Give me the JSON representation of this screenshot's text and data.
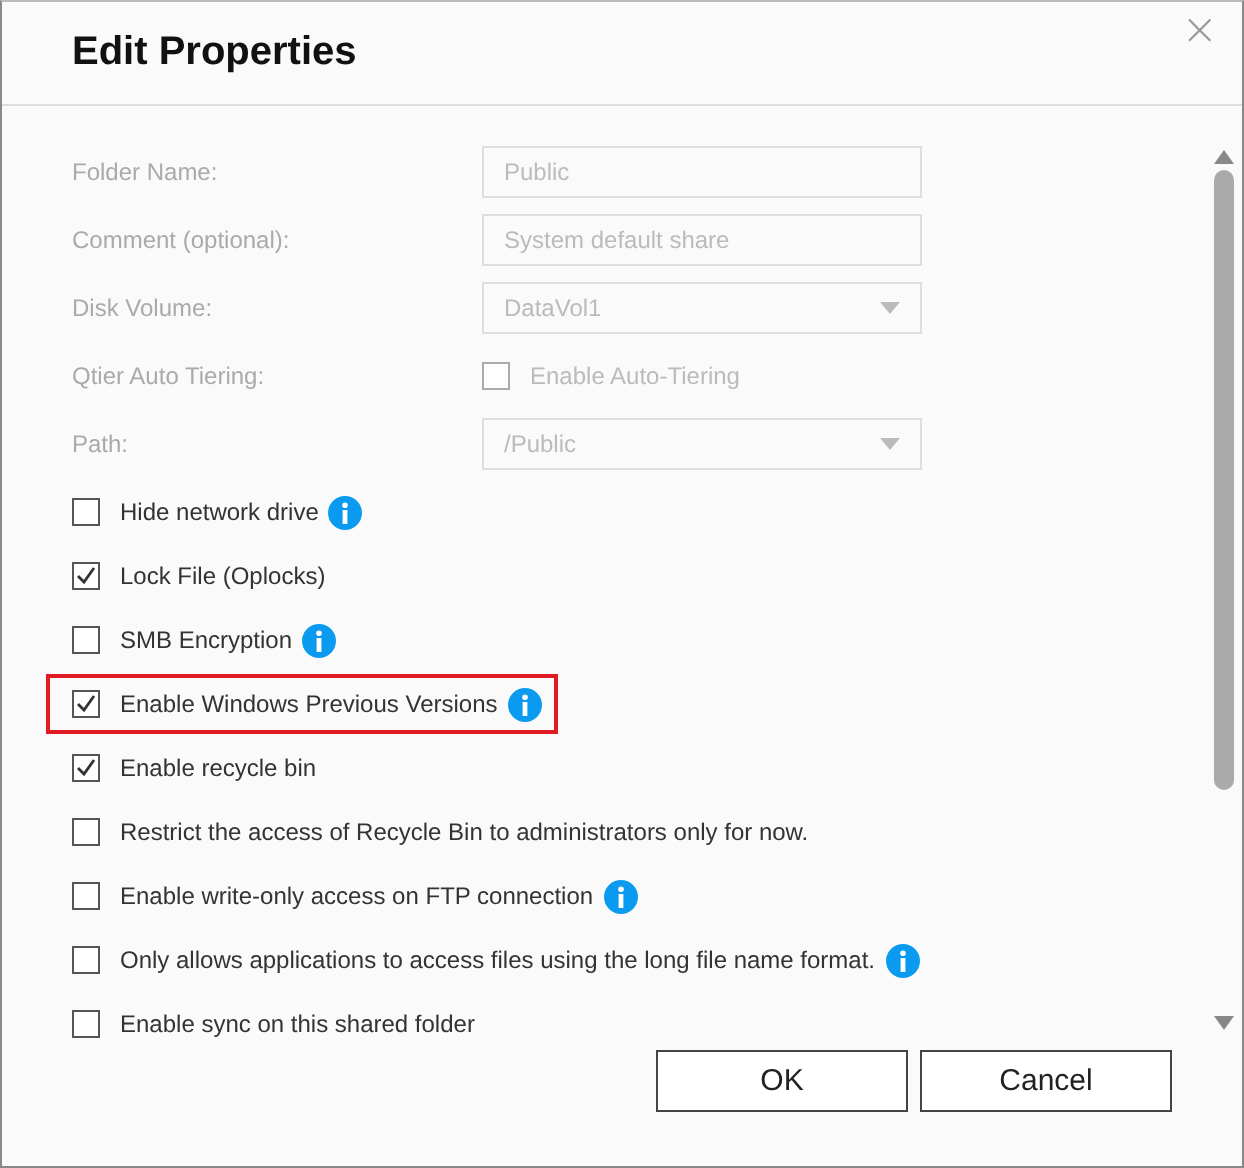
{
  "dialog": {
    "title": "Edit Properties",
    "close": "×"
  },
  "fields": [
    {
      "kind": "text",
      "label": "Folder Name:",
      "value": "Public",
      "disabled": true
    },
    {
      "kind": "text",
      "label": "Comment (optional):",
      "placeholder": "System default share",
      "disabled": true
    },
    {
      "kind": "select",
      "label": "Disk Volume:",
      "value": "DataVol1",
      "disabled": true
    },
    {
      "kind": "checkbox",
      "label": "Qtier Auto Tiering:",
      "option": "Enable Auto-Tiering",
      "checked": false,
      "disabled": true
    },
    {
      "kind": "select",
      "label": "Path:",
      "value": "/Public",
      "disabled": true
    }
  ],
  "options": [
    {
      "label": "Hide network drive",
      "checked": false,
      "info": true,
      "highlighted": false
    },
    {
      "label": "Lock File (Oplocks)",
      "checked": true,
      "info": false,
      "highlighted": false
    },
    {
      "label": "SMB Encryption",
      "checked": false,
      "info": true,
      "highlighted": false
    },
    {
      "label": "Enable Windows Previous Versions",
      "checked": true,
      "info": true,
      "highlighted": true
    },
    {
      "label": "Enable recycle bin",
      "checked": true,
      "info": false,
      "highlighted": false
    },
    {
      "label": "Restrict the access of Recycle Bin to administrators only for now.",
      "checked": false,
      "info": false,
      "highlighted": false
    },
    {
      "label": "Enable write-only access on FTP connection",
      "checked": false,
      "info": true,
      "highlighted": false
    },
    {
      "label": "Only allows applications to access files using the long file name format.",
      "checked": false,
      "info": true,
      "highlighted": false
    },
    {
      "label": "Enable sync on this shared folder",
      "checked": false,
      "info": false,
      "highlighted": false
    }
  ],
  "buttons": [
    "OK",
    "Cancel"
  ]
}
